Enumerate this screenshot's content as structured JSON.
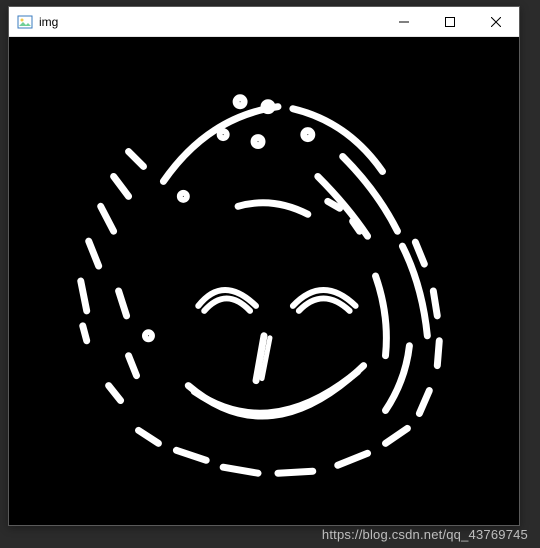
{
  "window": {
    "title": "img",
    "icon": "image-icon",
    "controls": {
      "minimize": "—",
      "maximize": "□",
      "close": "✕"
    }
  },
  "content": {
    "type": "edge-detected-image",
    "description": "smiley-face-edges"
  },
  "watermark": "https://blog.csdn.net/qq_43769745"
}
